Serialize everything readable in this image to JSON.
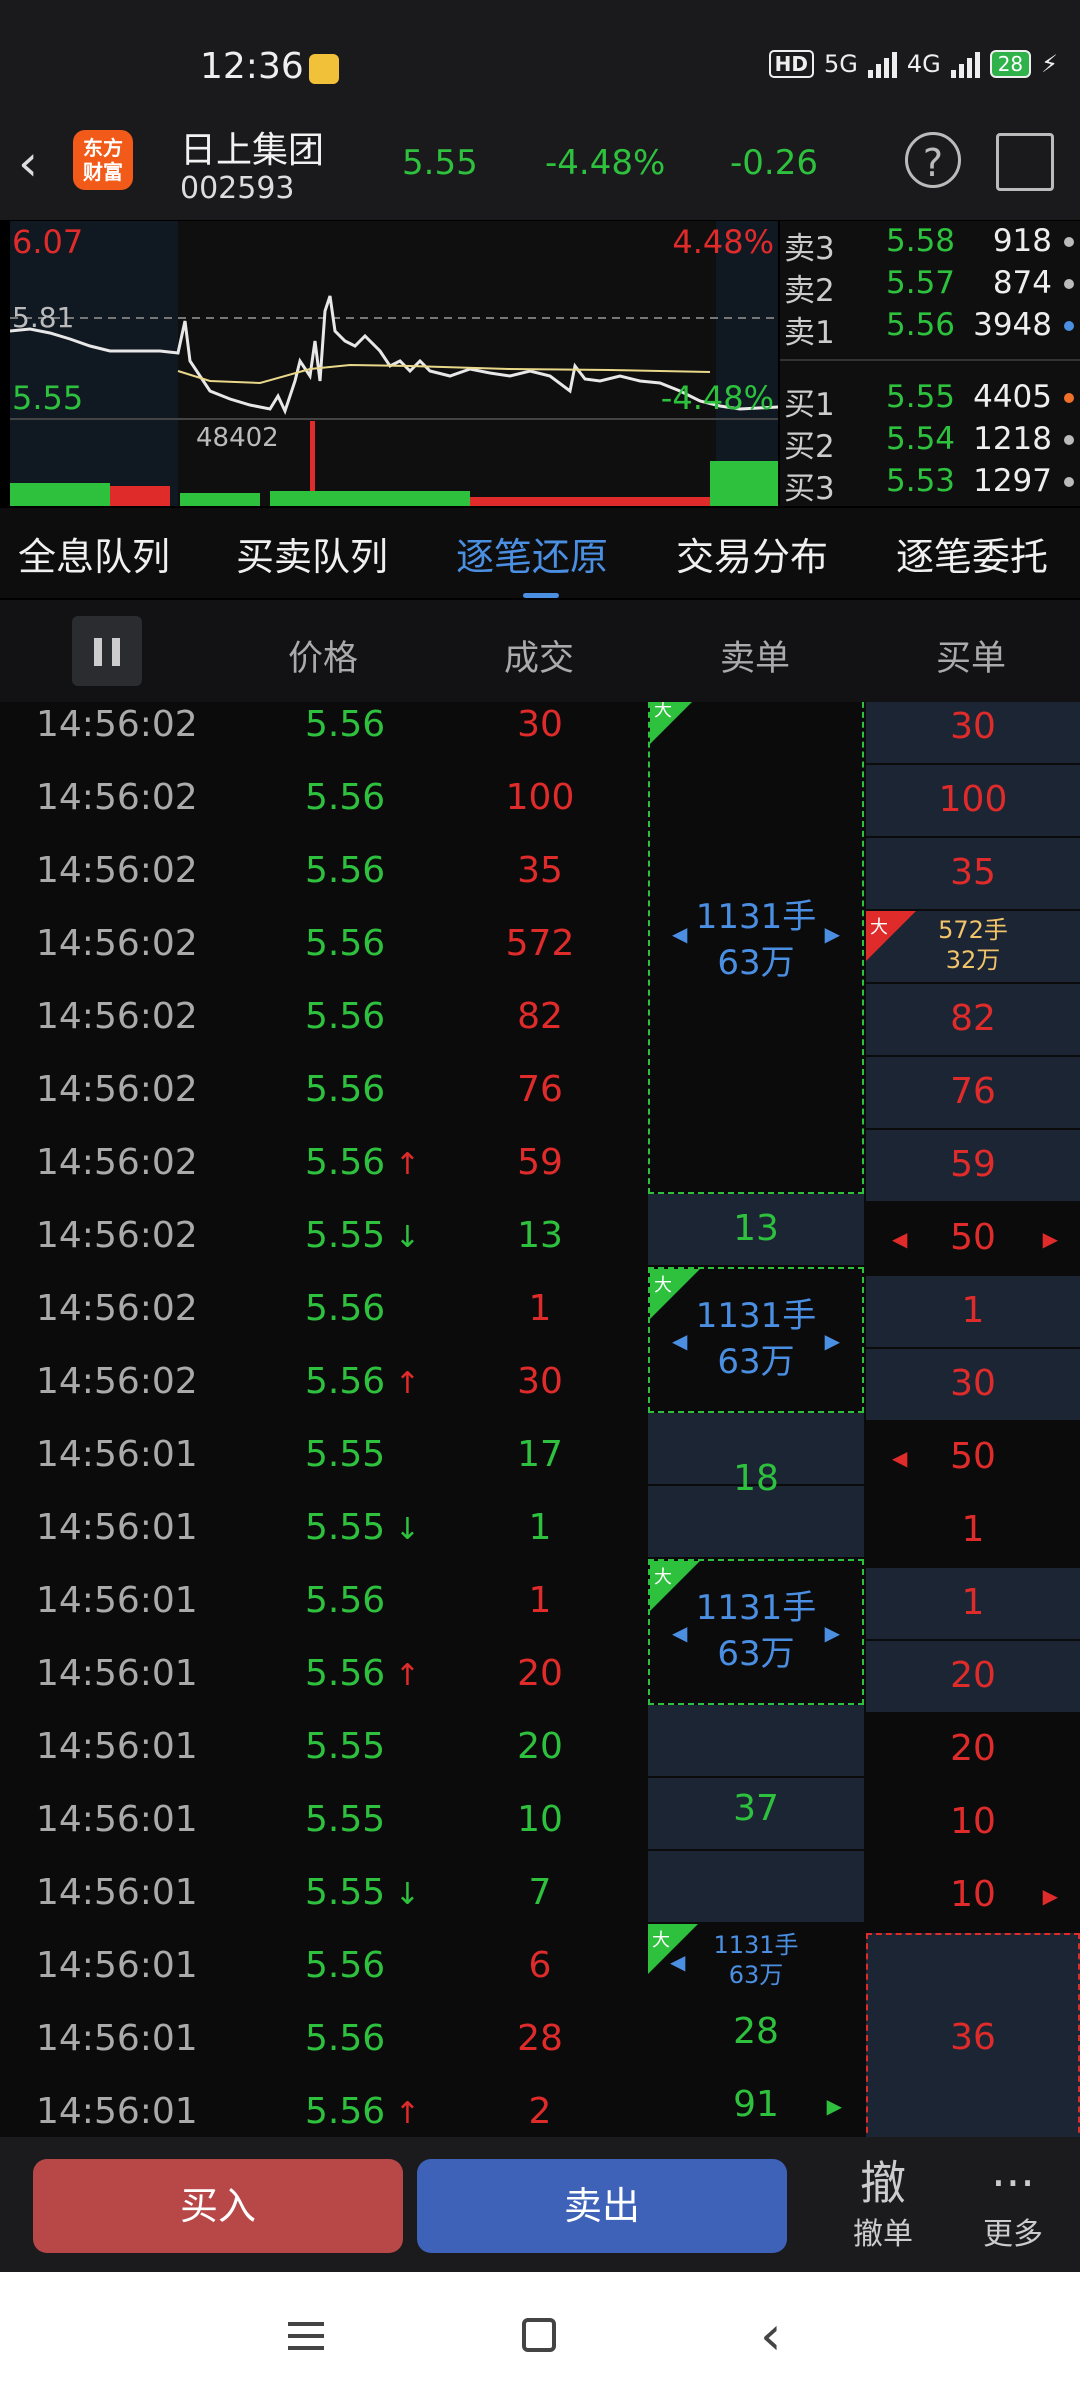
{
  "status": {
    "time": "12:36",
    "hd": "HD",
    "net1": "5G",
    "net2": "4G",
    "battery": "28"
  },
  "header": {
    "logo_line1": "东方",
    "logo_line2": "财富",
    "name": "日上集团",
    "code": "002593",
    "price": "5.55",
    "change_pct": "-4.48%",
    "change": "-0.26",
    "help": "?"
  },
  "chart": {
    "high": "6.07",
    "high_pct": "4.48%",
    "ref": "5.81",
    "low": "5.55",
    "low_pct": "-4.48%",
    "volume": "48402"
  },
  "quotes": [
    {
      "label": "卖3",
      "price": "5.58",
      "vol": "918",
      "dot": "#bbbbbb"
    },
    {
      "label": "卖2",
      "price": "5.57",
      "vol": "874",
      "dot": "#bbbbbb"
    },
    {
      "label": "卖1",
      "price": "5.56",
      "vol": "3948",
      "dot": "#4b8fe2"
    },
    {
      "label": "买1",
      "price": "5.55",
      "vol": "4405",
      "dot": "#f0702a"
    },
    {
      "label": "买2",
      "price": "5.54",
      "vol": "1218",
      "dot": "#bbbbbb"
    },
    {
      "label": "买3",
      "price": "5.53",
      "vol": "1297",
      "dot": "#bbbbbb"
    }
  ],
  "tabs": [
    "全息队列",
    "买卖队列",
    "逐笔还原",
    "交易分布",
    "逐笔委托"
  ],
  "columns": {
    "price": "价格",
    "deal": "成交",
    "sell": "卖单",
    "buy": "买单"
  },
  "rows": [
    {
      "time": "14:56:02",
      "price": "5.56",
      "dir": "",
      "vol": "30",
      "vc": "red"
    },
    {
      "time": "14:56:02",
      "price": "5.56",
      "dir": "",
      "vol": "100",
      "vc": "red"
    },
    {
      "time": "14:56:02",
      "price": "5.56",
      "dir": "",
      "vol": "35",
      "vc": "red"
    },
    {
      "time": "14:56:02",
      "price": "5.56",
      "dir": "",
      "vol": "572",
      "vc": "red"
    },
    {
      "time": "14:56:02",
      "price": "5.56",
      "dir": "",
      "vol": "82",
      "vc": "red"
    },
    {
      "time": "14:56:02",
      "price": "5.56",
      "dir": "",
      "vol": "76",
      "vc": "red"
    },
    {
      "time": "14:56:02",
      "price": "5.56",
      "dir": "up",
      "vol": "59",
      "vc": "red"
    },
    {
      "time": "14:56:02",
      "price": "5.55",
      "dir": "down",
      "vol": "13",
      "vc": "green"
    },
    {
      "time": "14:56:02",
      "price": "5.56",
      "dir": "",
      "vol": "1",
      "vc": "red"
    },
    {
      "time": "14:56:02",
      "price": "5.56",
      "dir": "up",
      "vol": "30",
      "vc": "red"
    },
    {
      "time": "14:56:01",
      "price": "5.55",
      "dir": "",
      "vol": "17",
      "vc": "green"
    },
    {
      "time": "14:56:01",
      "price": "5.55",
      "dir": "down",
      "vol": "1",
      "vc": "green"
    },
    {
      "time": "14:56:01",
      "price": "5.56",
      "dir": "",
      "vol": "1",
      "vc": "red"
    },
    {
      "time": "14:56:01",
      "price": "5.56",
      "dir": "up",
      "vol": "20",
      "vc": "red"
    },
    {
      "time": "14:56:01",
      "price": "5.55",
      "dir": "",
      "vol": "20",
      "vc": "green"
    },
    {
      "time": "14:56:01",
      "price": "5.55",
      "dir": "",
      "vol": "10",
      "vc": "green"
    },
    {
      "time": "14:56:01",
      "price": "5.55",
      "dir": "down",
      "vol": "7",
      "vc": "green"
    },
    {
      "time": "14:56:01",
      "price": "5.56",
      "dir": "",
      "vol": "6",
      "vc": "red"
    },
    {
      "time": "14:56:01",
      "price": "5.56",
      "dir": "",
      "vol": "28",
      "vc": "red"
    },
    {
      "time": "14:56:01",
      "price": "5.56",
      "dir": "up",
      "vol": "2",
      "vc": "red"
    }
  ],
  "sell": {
    "big": "大",
    "order_a": "1131手",
    "order_b": "63万",
    "v13": "13",
    "v18": "18",
    "v37": "37",
    "v28": "28",
    "v91": "91"
  },
  "buy": {
    "b30": "30",
    "b100": "100",
    "b35": "35",
    "big": "大",
    "big_a": "572手",
    "big_b": "32万",
    "b82": "82",
    "b76": "76",
    "b59": "59",
    "b50": "50",
    "b1": "1",
    "b30b": "30",
    "b50b": "50",
    "b1b": "1",
    "b1c": "1",
    "b20": "20",
    "b20b": "20",
    "b10": "10",
    "b10b": "10",
    "b36": "36"
  },
  "bottom": {
    "buy": "买入",
    "sell": "卖出",
    "cancel_icon": "撤",
    "cancel": "撤单",
    "more_icon": "···",
    "more": "更多"
  }
}
